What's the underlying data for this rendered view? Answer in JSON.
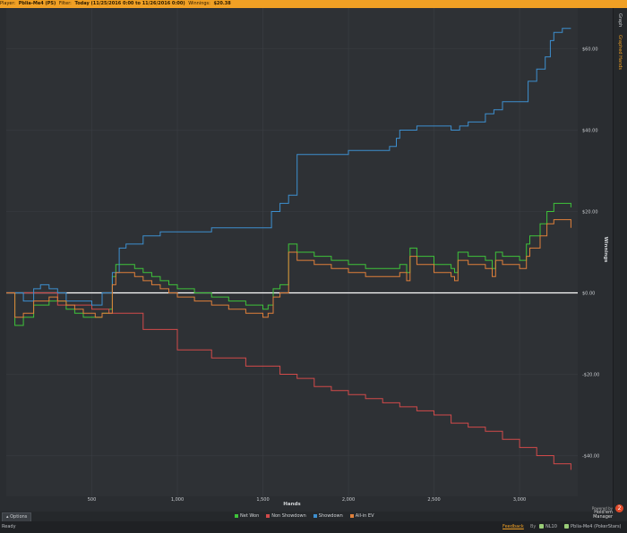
{
  "header": {
    "player_label": "Player:",
    "player_value": "Pblia-Me4 (PS)",
    "filter_label": "Filter:",
    "filter_value": "Today (11/25/2016 0:00 to 11/26/2016 0:00)",
    "winnings_label": "Winnings:",
    "winnings_value": "$20.38"
  },
  "sidebar": {
    "tab_graph": "Graph",
    "tab_graphed_hands": "Graphed Hands"
  },
  "footer": {
    "options_label": "Options",
    "powered_by": "Powered by",
    "brand": "Hold'em Manager",
    "brand_badge": "2"
  },
  "status": {
    "ready": "Ready",
    "feedback": "Feedback",
    "separator": "By",
    "stake": "NL10",
    "player": "Pblia-Me4 (PokerStars)"
  },
  "chart_data": {
    "type": "line",
    "xlabel": "Hands",
    "ylabel": "Winnings",
    "xlim": [
      0,
      3340
    ],
    "ylim": [
      -50,
      70
    ],
    "x_ticks": [
      500,
      1000,
      1500,
      2000,
      2500,
      3000
    ],
    "x_tick_labels": [
      "500",
      "1,000",
      "1,500",
      "2,000",
      "2,500",
      "3,000"
    ],
    "y_ticks": [
      -40,
      -20,
      0,
      20,
      40,
      60
    ],
    "y_tick_labels": [
      "-$40.00",
      "-$20.00",
      "$0.00",
      "$20.00",
      "$40.00",
      "$60.00"
    ],
    "grid": true,
    "zero_line": true,
    "legend_position": "bottom-center",
    "series": [
      {
        "name": "Net Won",
        "color": "#3ec43a",
        "x": [
          0,
          50,
          100,
          160,
          250,
          300,
          350,
          400,
          450,
          520,
          560,
          600,
          620,
          640,
          700,
          750,
          800,
          850,
          900,
          950,
          1000,
          1100,
          1200,
          1300,
          1400,
          1500,
          1530,
          1560,
          1600,
          1650,
          1700,
          1800,
          1900,
          2000,
          2100,
          2200,
          2300,
          2340,
          2360,
          2400,
          2500,
          2600,
          2620,
          2640,
          2700,
          2800,
          2840,
          2860,
          2900,
          3000,
          3040,
          3060,
          3100,
          3120,
          3160,
          3200,
          3300
        ],
        "y": [
          0,
          -8,
          -6,
          -3,
          -2,
          -2,
          -4,
          -5,
          -6,
          -6,
          -5,
          -4,
          4,
          7,
          7,
          6,
          5,
          4,
          3,
          2,
          1,
          0,
          -1,
          -2,
          -3,
          -4,
          -3,
          1,
          2,
          12,
          10,
          9,
          8,
          7,
          6,
          6,
          7,
          5,
          11,
          9,
          7,
          6,
          5,
          10,
          9,
          8,
          6,
          10,
          9,
          8,
          12,
          14,
          14,
          17,
          20,
          22,
          21
        ]
      },
      {
        "name": "Non Showdown",
        "color": "#d24a4a",
        "x": [
          0,
          300,
          500,
          600,
          800,
          1000,
          1200,
          1400,
          1600,
          1700,
          1800,
          1900,
          2000,
          2100,
          2200,
          2300,
          2400,
          2500,
          2600,
          2700,
          2800,
          2900,
          3000,
          3100,
          3200,
          3300
        ],
        "y": [
          0,
          -3,
          -4,
          -5,
          -9,
          -14,
          -16,
          -18,
          -20,
          -21,
          -23,
          -24,
          -25,
          -26,
          -27,
          -28,
          -29,
          -30,
          -32,
          -33,
          -34,
          -36,
          -38,
          -40,
          -42,
          -43.5
        ]
      },
      {
        "name": "Showdown",
        "color": "#3d8fcf",
        "x": [
          0,
          100,
          160,
          200,
          250,
          300,
          350,
          500,
          560,
          620,
          660,
          700,
          800,
          900,
          1000,
          1100,
          1200,
          1300,
          1400,
          1500,
          1550,
          1600,
          1650,
          1700,
          1750,
          1800,
          1900,
          2000,
          2100,
          2200,
          2240,
          2280,
          2300,
          2350,
          2400,
          2500,
          2600,
          2650,
          2700,
          2800,
          2850,
          2900,
          2950,
          3000,
          3050,
          3100,
          3150,
          3180,
          3200,
          3250,
          3300
        ],
        "y": [
          0,
          -2,
          1,
          2,
          1,
          0,
          -2,
          -3,
          0,
          5,
          11,
          12,
          14,
          15,
          15,
          15,
          16,
          16,
          16,
          16,
          20,
          22,
          24,
          34,
          34,
          34,
          34,
          35,
          35,
          35,
          36,
          38,
          40,
          40,
          41,
          41,
          40,
          41,
          42,
          44,
          45,
          47,
          47,
          47,
          52,
          55,
          58,
          62,
          64,
          65,
          65
        ]
      },
      {
        "name": "All-in EV",
        "color": "#e0803a",
        "x": [
          0,
          50,
          100,
          160,
          250,
          300,
          350,
          400,
          450,
          520,
          560,
          600,
          620,
          640,
          700,
          750,
          800,
          850,
          900,
          950,
          1000,
          1100,
          1200,
          1300,
          1400,
          1500,
          1530,
          1560,
          1600,
          1650,
          1700,
          1800,
          1900,
          2000,
          2100,
          2200,
          2300,
          2340,
          2360,
          2400,
          2500,
          2600,
          2620,
          2640,
          2700,
          2800,
          2840,
          2860,
          2900,
          3000,
          3040,
          3060,
          3100,
          3120,
          3160,
          3200,
          3300
        ],
        "y": [
          0,
          -6,
          -5,
          -2,
          -1,
          -2,
          -3,
          -4,
          -5,
          -6,
          -5,
          -5,
          2,
          5,
          5,
          4,
          3,
          2,
          1,
          0,
          -1,
          -2,
          -3,
          -4,
          -5,
          -6,
          -5,
          -1,
          0,
          10,
          8,
          7,
          6,
          5,
          4,
          4,
          5,
          3,
          9,
          7,
          5,
          4,
          3,
          8,
          7,
          6,
          4,
          8,
          7,
          6,
          9,
          11,
          11,
          14,
          17,
          18,
          16
        ]
      }
    ]
  }
}
